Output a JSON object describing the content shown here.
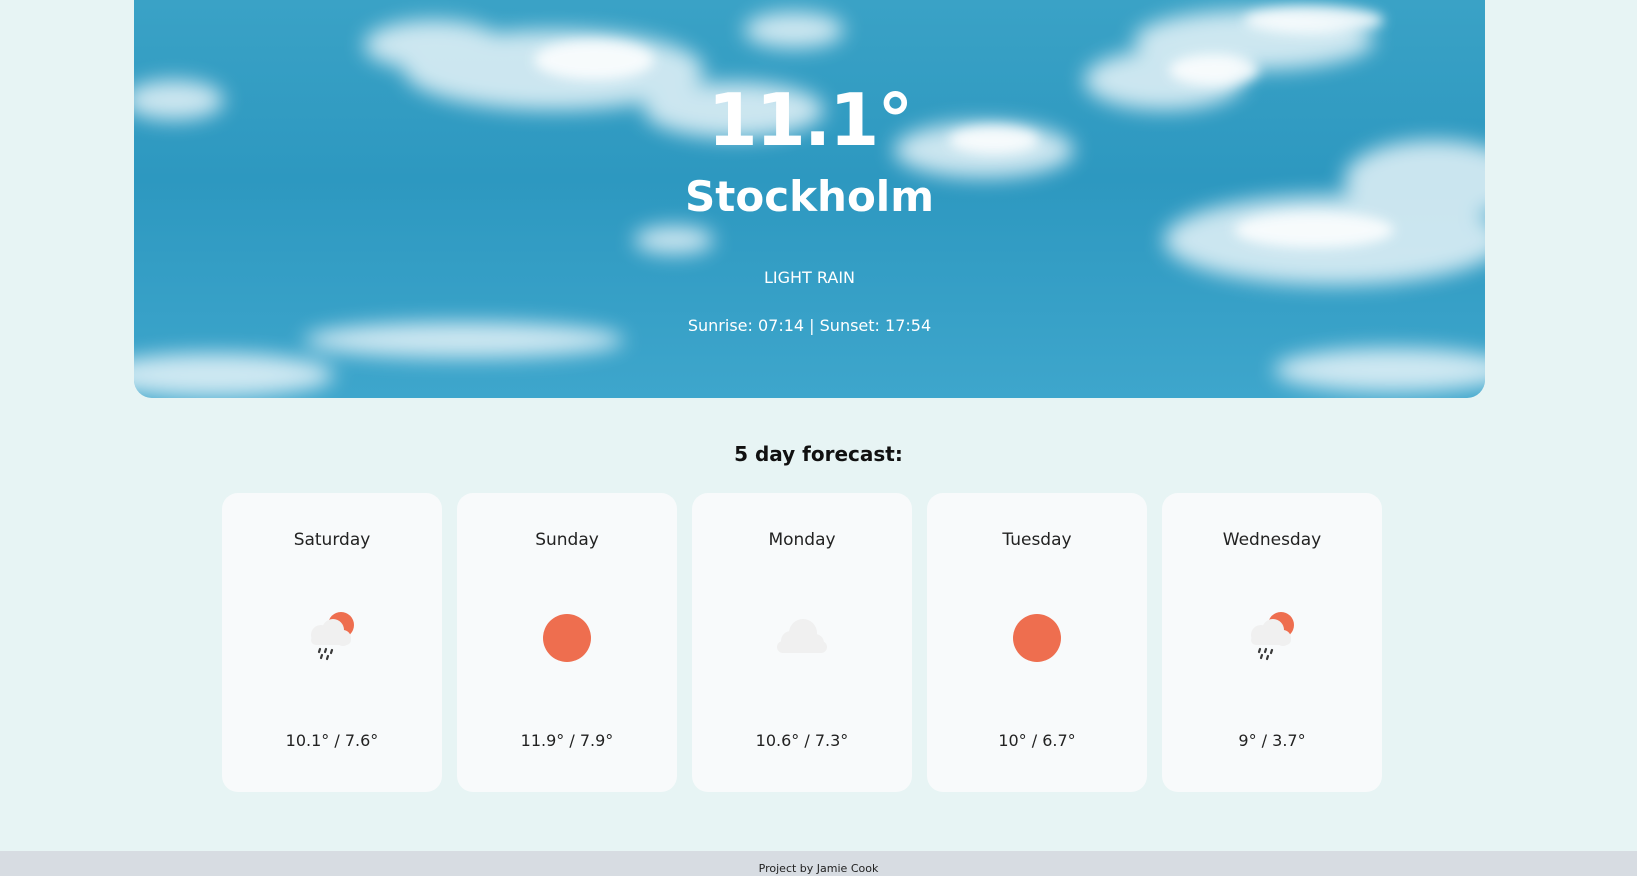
{
  "current": {
    "temperature": "11.1°",
    "city": "Stockholm",
    "description": "LIGHT RAIN",
    "sun_times": "Sunrise: 07:14 | Sunset: 17:54"
  },
  "forecast": {
    "heading": "5 day forecast:",
    "days": [
      {
        "day": "Saturday",
        "icon": "rain-sun-icon",
        "temps": "10.1° / 7.6°"
      },
      {
        "day": "Sunday",
        "icon": "sun-icon",
        "temps": "11.9° / 7.9°"
      },
      {
        "day": "Monday",
        "icon": "cloud-icon",
        "temps": "10.6° / 7.3°"
      },
      {
        "day": "Tuesday",
        "icon": "sun-icon",
        "temps": "10° / 6.7°"
      },
      {
        "day": "Wednesday",
        "icon": "rain-sun-icon",
        "temps": "9° / 3.7°"
      }
    ]
  },
  "footer": {
    "credit": "Project by Jamie Cook"
  },
  "colors": {
    "sun": "#ee6e4f",
    "cloud": "#f0f0f0",
    "page_background": "#e7f4f4",
    "card_background": "#f8fafb",
    "sky": "#2d98c0"
  }
}
